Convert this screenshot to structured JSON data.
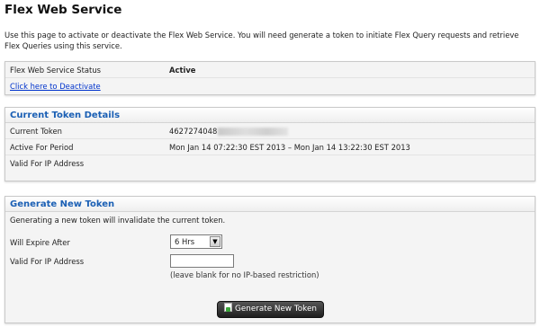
{
  "page": {
    "title": "Flex Web Service",
    "intro": "Use this page to activate or deactivate the Flex Web Service. You will need generate a token to initiate Flex Query requests and retrieve Flex Queries using this service."
  },
  "status": {
    "label": "Flex Web Service Status",
    "value": "Active",
    "deactivate_link": "Click here to Deactivate"
  },
  "current_token": {
    "heading": "Current Token Details",
    "rows": [
      {
        "label": "Current Token",
        "value": "4627274048"
      },
      {
        "label": "Active For Period",
        "value": "Mon Jan 14 07:22:30 EST 2013 – Mon Jan 14 13:22:30 EST 2013"
      },
      {
        "label": "Valid For IP Address",
        "value": ""
      }
    ]
  },
  "generate": {
    "heading": "Generate New Token",
    "warning": "Generating a new token will invalidate the current token.",
    "expire_label": "Will Expire After",
    "expire_value": "6 Hrs",
    "ip_label": "Valid For IP Address",
    "ip_value": "",
    "ip_hint": "(leave blank for no IP-based restriction)",
    "button_label": "Generate New Token"
  },
  "icons": {
    "dropdown": "chevron-down-icon",
    "generate": "document-add-icon"
  }
}
